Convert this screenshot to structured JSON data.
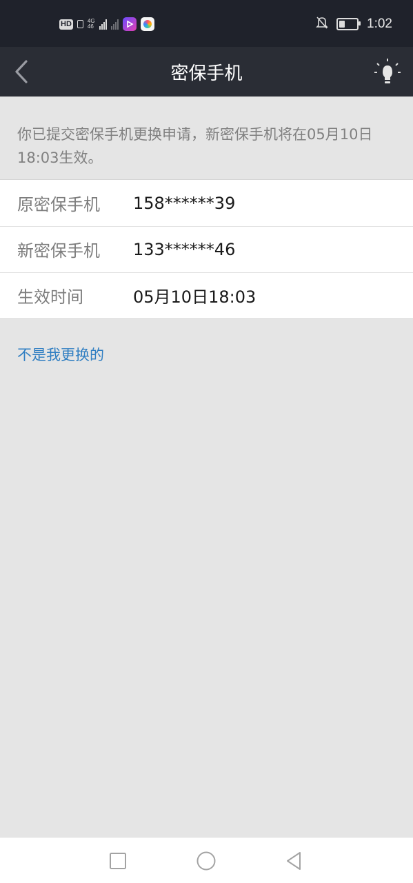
{
  "status_bar": {
    "hd": "HD",
    "network": "4G",
    "network_sub": "46",
    "time": "1:02",
    "icons": [
      "hd-icon",
      "sim-icon",
      "signal-icon",
      "signal-off-icon",
      "video-app-icon",
      "photo-app-icon",
      "bell-off-icon",
      "battery-icon"
    ]
  },
  "header": {
    "title": "密保手机",
    "back_icon": "back-chevron-icon",
    "right_icon": "lightbulb-icon"
  },
  "notice": "你已提交密保手机更换申请，新密保手机将在05月10日18:03生效。",
  "rows": [
    {
      "label": "原密保手机",
      "value": "158******39"
    },
    {
      "label": "新密保手机",
      "value": "133******46"
    },
    {
      "label": "生效时间",
      "value": "05月10日18:03"
    }
  ],
  "link": {
    "not_me": "不是我更换的"
  },
  "nav": {
    "icons": [
      "recent-apps-icon",
      "home-icon",
      "back-triangle-icon"
    ]
  },
  "colors": {
    "status_bar_bg": "#1f222b",
    "header_bg": "#2a2d35",
    "page_bg": "#e5e5e5",
    "link": "#2f7ec2"
  }
}
